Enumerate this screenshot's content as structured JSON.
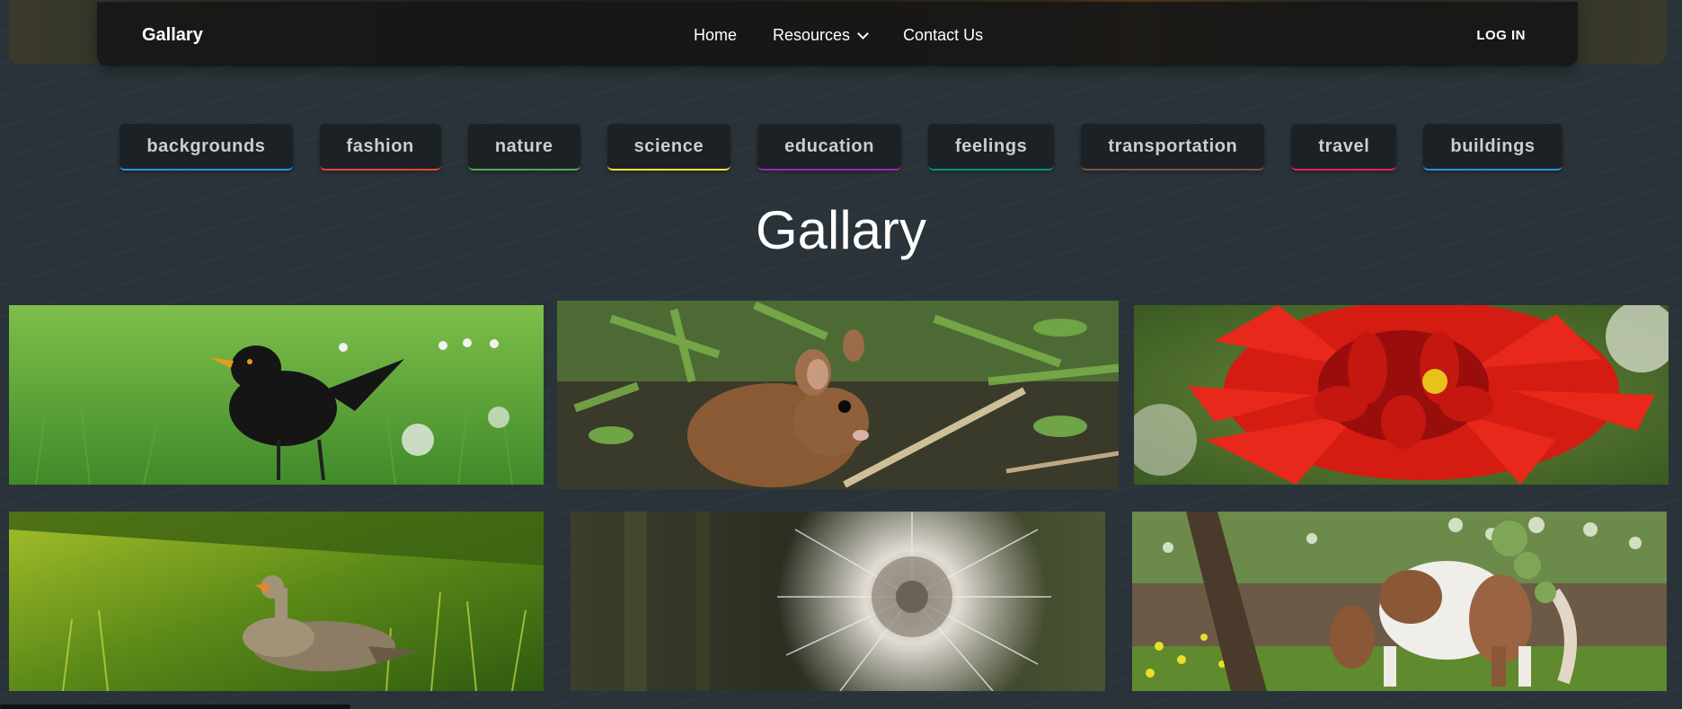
{
  "nav": {
    "brand": "Gallary",
    "links": [
      "Home",
      "Resources",
      "Contact Us"
    ],
    "login": "LOG IN"
  },
  "categories": [
    {
      "label": "backgrounds",
      "color": "#2196f3"
    },
    {
      "label": "fashion",
      "color": "#f44336"
    },
    {
      "label": "nature",
      "color": "#4caf50"
    },
    {
      "label": "science",
      "color": "#ffeb3b"
    },
    {
      "label": "education",
      "color": "#9c27b0"
    },
    {
      "label": "feelings",
      "color": "#009688"
    },
    {
      "label": "transportation",
      "color": "#795548"
    },
    {
      "label": "travel",
      "color": "#e91e63"
    },
    {
      "label": "buildings",
      "color": "#2196f3"
    }
  ],
  "page_title": "Gallary",
  "gallery": [
    {
      "subject": "blackbird-image"
    },
    {
      "subject": "mouse-image"
    },
    {
      "subject": "red-dahlia-image"
    },
    {
      "subject": "goose-image"
    },
    {
      "subject": "dandelion-seedhead-image"
    },
    {
      "subject": "pony-image"
    }
  ]
}
